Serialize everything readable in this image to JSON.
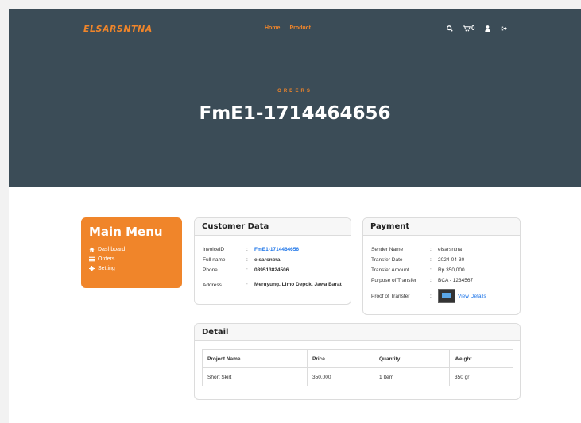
{
  "brand": "ELSARSNTNA",
  "nav": [
    "Home",
    "Product"
  ],
  "cart_count": "0",
  "icons": {
    "search": "search-icon",
    "cart": "cart-icon",
    "user": "user-icon",
    "logout": "logout-icon"
  },
  "hero": {
    "eyebrow": "ORDERS",
    "title": "FmE1-1714464656"
  },
  "menu": {
    "title": "Main Menu",
    "items": [
      "Dashboard",
      "Orders",
      "Setting"
    ]
  },
  "customer": {
    "title": "Customer Data",
    "rows": [
      {
        "label": "InvoiceID",
        "value": "FmE1-1714464656"
      },
      {
        "label": "Full name",
        "value": "elsarsntna"
      },
      {
        "label": "Phone",
        "value": "089513824506"
      },
      {
        "label": "Address",
        "value": "Meruyung, Limo Depok, Jawa Barat"
      }
    ]
  },
  "payment": {
    "title": "Payment",
    "rows": [
      {
        "label": "Sender Name",
        "value": "elsarsntna"
      },
      {
        "label": "Transfer Date",
        "value": "2024-04-30"
      },
      {
        "label": "Transfer Amount",
        "value": "Rp 350,000"
      },
      {
        "label": "Purpose of Transfer",
        "value": "BCA - 1234567"
      },
      {
        "label": "Proof of Transfer",
        "value": "View Details"
      }
    ]
  },
  "detail": {
    "title": "Detail",
    "headers": [
      "Project Name",
      "Price",
      "Quantity",
      "Weight"
    ],
    "rows": [
      [
        "Short Skirt",
        "350,000",
        "1 Item",
        "350 gr"
      ]
    ]
  },
  "colors": {
    "accent": "#f0852a",
    "hero": "#3b4c57",
    "link": "#1a73e8"
  }
}
